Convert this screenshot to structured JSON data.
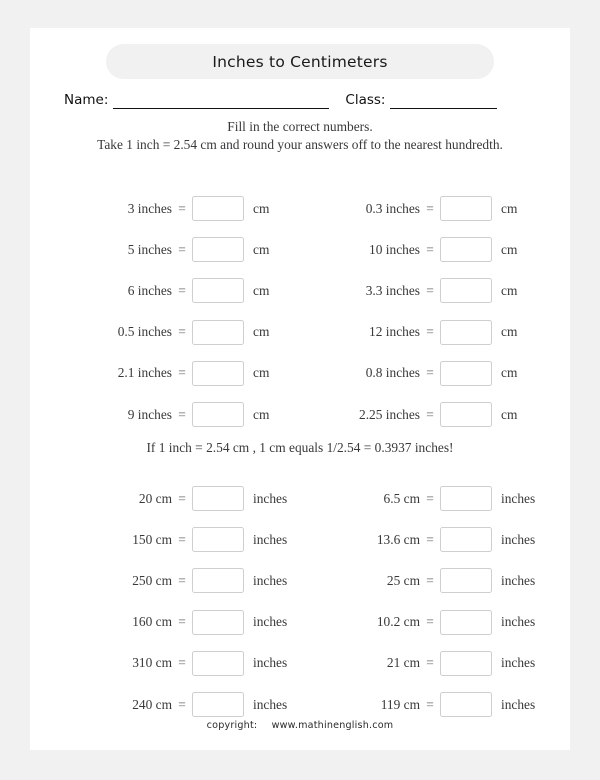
{
  "worksheet": {
    "title": "Inches to Centimeters",
    "name_label": "Name:",
    "class_label": "Class:",
    "instruction_line_1": "Fill in the correct numbers.",
    "instruction_line_2": "Take 1 inch = 2.54 cm and round your answers off to the nearest hundredth.",
    "middle_note": "If 1 inch = 2.54 cm , 1 cm equals 1/2.54 = 0.3937 inches!",
    "equals_sign": "=",
    "answer_placeholder": "",
    "footer": {
      "copyright_label": "copyright:",
      "site": "www.mathinenglish.com"
    },
    "colors": {
      "page_background": "#ffffff",
      "outer_background": "#f1f1f1",
      "banner_background": "#f1f1f1",
      "text": "#39393b",
      "heading_text": "#1a1a1a",
      "box_border": "#cfcfcf",
      "rule_line": "#111111"
    }
  },
  "section_one": {
    "unit_from": "inches",
    "unit_to": "cm",
    "rows": [
      {
        "left": {
          "value": "3 inches",
          "unit": "cm"
        },
        "right": {
          "value": "0.3 inches",
          "unit": "cm"
        }
      },
      {
        "left": {
          "value": "5 inches",
          "unit": "cm"
        },
        "right": {
          "value": "10 inches",
          "unit": "cm"
        }
      },
      {
        "left": {
          "value": "6 inches",
          "unit": "cm"
        },
        "right": {
          "value": "3.3 inches",
          "unit": "cm"
        }
      },
      {
        "left": {
          "value": "0.5 inches",
          "unit": "cm"
        },
        "right": {
          "value": "12 inches",
          "unit": "cm"
        }
      },
      {
        "left": {
          "value": "2.1 inches",
          "unit": "cm"
        },
        "right": {
          "value": "0.8 inches",
          "unit": "cm"
        }
      },
      {
        "left": {
          "value": "9 inches",
          "unit": "cm"
        },
        "right": {
          "value": "2.25 inches",
          "unit": "cm"
        }
      }
    ]
  },
  "section_two": {
    "unit_from": "cm",
    "unit_to": "inches",
    "rows": [
      {
        "left": {
          "value": "20 cm",
          "unit": "inches"
        },
        "right": {
          "value": "6.5 cm",
          "unit": "inches"
        }
      },
      {
        "left": {
          "value": "150 cm",
          "unit": "inches"
        },
        "right": {
          "value": "13.6 cm",
          "unit": "inches"
        }
      },
      {
        "left": {
          "value": "250 cm",
          "unit": "inches"
        },
        "right": {
          "value": "25 cm",
          "unit": "inches"
        }
      },
      {
        "left": {
          "value": "160 cm",
          "unit": "inches"
        },
        "right": {
          "value": "10.2 cm",
          "unit": "inches"
        }
      },
      {
        "left": {
          "value": "310 cm",
          "unit": "inches"
        },
        "right": {
          "value": "21 cm",
          "unit": "inches"
        }
      },
      {
        "left": {
          "value": "240 cm",
          "unit": "inches"
        },
        "right": {
          "value": "119 cm",
          "unit": "inches"
        }
      }
    ]
  }
}
